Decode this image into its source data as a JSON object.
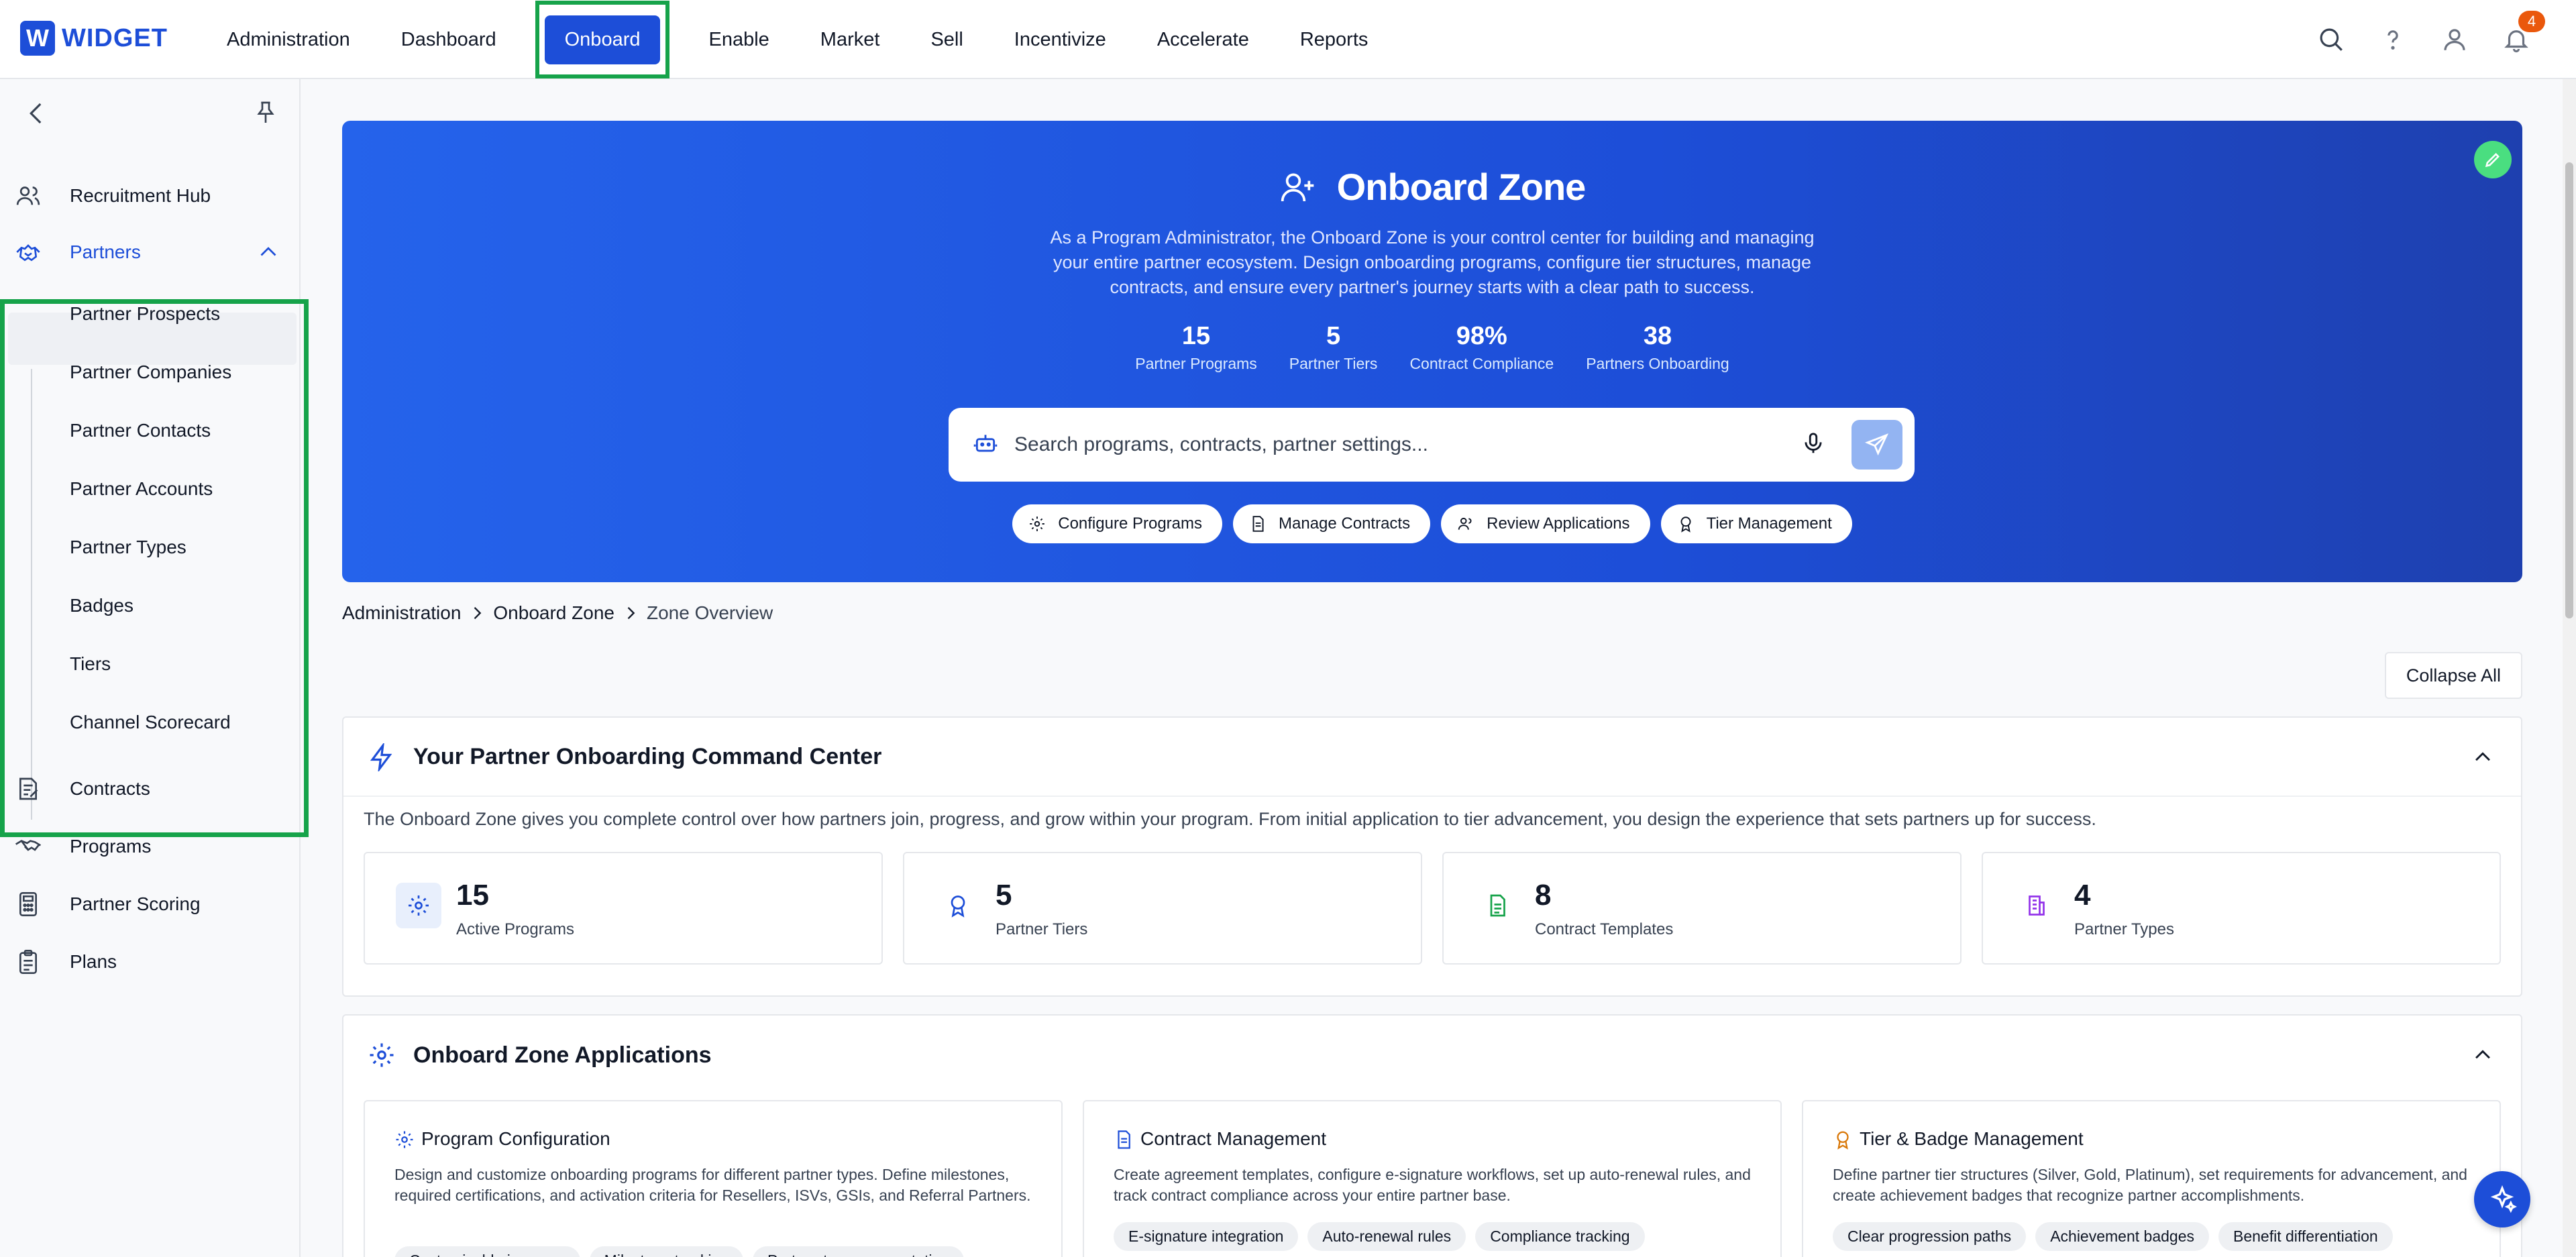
{
  "brand": {
    "logo_letter": "W",
    "name": "WIDGET",
    "color": "#1d4ed8"
  },
  "nav": {
    "items": [
      {
        "label": "Administration"
      },
      {
        "label": "Dashboard"
      },
      {
        "label": "Onboard",
        "active": true
      },
      {
        "label": "Enable"
      },
      {
        "label": "Market"
      },
      {
        "label": "Sell"
      },
      {
        "label": "Incentivize"
      },
      {
        "label": "Accelerate"
      },
      {
        "label": "Reports"
      }
    ],
    "icons": [
      "search-icon",
      "help-icon",
      "user-icon",
      "bell-icon"
    ],
    "notification_count": "4"
  },
  "sidebar": {
    "items": [
      {
        "label": "Recruitment Hub",
        "icon": "users-icon"
      },
      {
        "label": "Partners",
        "icon": "handshake-icon",
        "expanded": true
      },
      {
        "label": "Contracts",
        "icon": "contract-icon"
      },
      {
        "label": "Programs",
        "icon": "handshake-icon"
      },
      {
        "label": "Partner Scoring",
        "icon": "calculator-icon"
      },
      {
        "label": "Plans",
        "icon": "clipboard-icon"
      }
    ],
    "partner_sub_items": [
      "Partner Prospects",
      "Partner Companies",
      "Partner Contacts",
      "Partner Accounts",
      "Partner Types",
      "Badges",
      "Tiers",
      "Channel Scorecard"
    ]
  },
  "hero": {
    "title": "Onboard Zone",
    "description_lines": [
      "As a Program Administrator, the Onboard Zone is your control center for building and managing",
      "your entire partner ecosystem. Design onboarding programs, configure tier structures, manage",
      "contracts, and ensure every partner's journey starts with a clear path to success."
    ],
    "stats": [
      {
        "value": "15",
        "label": "Partner Programs"
      },
      {
        "value": "5",
        "label": "Partner Tiers"
      },
      {
        "value": "98%",
        "label": "Contract Compliance"
      },
      {
        "value": "38",
        "label": "Partners Onboarding"
      }
    ],
    "search_placeholder": "Search programs, contracts, partner settings...",
    "chips": [
      {
        "label": "Configure Programs",
        "icon": "gear-icon"
      },
      {
        "label": "Manage Contracts",
        "icon": "document-icon"
      },
      {
        "label": "Review Applications",
        "icon": "users-icon"
      },
      {
        "label": "Tier Management",
        "icon": "award-icon"
      }
    ]
  },
  "breadcrumb": [
    "Administration",
    "Onboard Zone",
    "Zone Overview"
  ],
  "collapse_all_label": "Collapse All",
  "command_center": {
    "title": "Your Partner Onboarding Command Center",
    "description": "The Onboard Zone gives you complete control over how partners join, progress, and grow within your program. From initial application to tier advancement, you design the experience that sets partners up for success.",
    "cards": [
      {
        "value": "15",
        "label": "Active Programs",
        "icon": "gear-icon",
        "color": "#1d4ed8"
      },
      {
        "value": "5",
        "label": "Partner Tiers",
        "icon": "award-icon",
        "color": "#1d4ed8"
      },
      {
        "value": "8",
        "label": "Contract Templates",
        "icon": "document-icon",
        "color": "#16a34a"
      },
      {
        "value": "4",
        "label": "Partner Types",
        "icon": "building-icon",
        "color": "#9333ea"
      }
    ]
  },
  "applications": {
    "title": "Onboard Zone Applications",
    "items": [
      {
        "title": "Program Configuration",
        "icon": "gear-icon",
        "icon_color": "#1d4ed8",
        "description": "Design and customize onboarding programs for different partner types. Define milestones, required certifications, and activation criteria for Resellers, ISVs, GSIs, and Referral Partners.",
        "tags": [
          "Customizable journeys",
          "Milestone tracking",
          "Partner-type segmentation"
        ]
      },
      {
        "title": "Contract Management",
        "icon": "document-icon",
        "icon_color": "#1d4ed8",
        "description": "Create agreement templates, configure e-signature workflows, set up auto-renewal rules, and track contract compliance across your entire partner base.",
        "tags": [
          "E-signature integration",
          "Auto-renewal rules",
          "Compliance tracking"
        ]
      },
      {
        "title": "Tier & Badge Management",
        "icon": "award-icon",
        "icon_color": "#d97706",
        "description": "Define partner tier structures (Silver, Gold, Platinum), set requirements for advancement, and create achievement badges that recognize partner accomplishments.",
        "tags": [
          "Clear progression paths",
          "Achievement badges",
          "Benefit differentiation"
        ]
      }
    ]
  },
  "colors": {
    "highlight": "#16a34a",
    "hero_bg": "#1d4ed8",
    "accent": "#1d4ed8"
  }
}
